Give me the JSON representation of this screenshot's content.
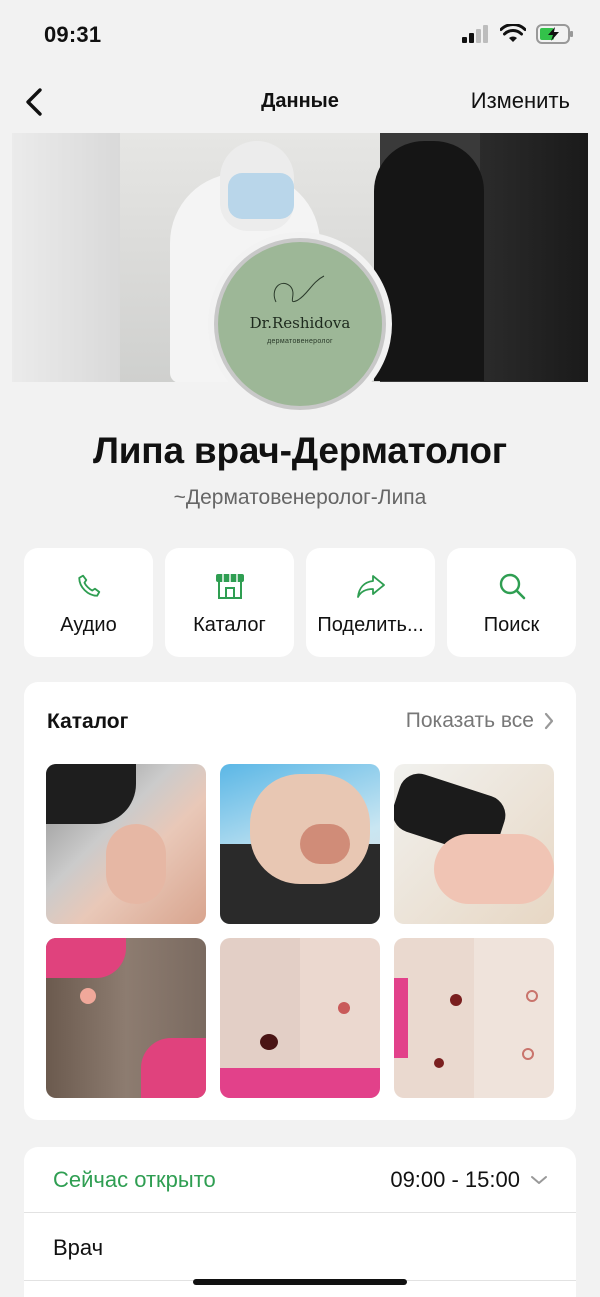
{
  "status_bar": {
    "time": "09:31"
  },
  "nav": {
    "title": "Данные",
    "edit_label": "Изменить"
  },
  "profile": {
    "avatar_brand": "Dr.Reshidova",
    "avatar_subtitle": "дерматовенеролог",
    "name": "Липа врач-Дерматолог",
    "subtitle": "~Дерматовенеролог-Липа"
  },
  "actions": [
    {
      "label": "Аудио",
      "icon": "phone-icon"
    },
    {
      "label": "Каталог",
      "icon": "store-icon"
    },
    {
      "label": "Поделить...",
      "icon": "share-icon"
    },
    {
      "label": "Поиск",
      "icon": "search-icon"
    }
  ],
  "catalog": {
    "title": "Каталог",
    "show_all_label": "Показать все"
  },
  "hours": {
    "status": "Сейчас открыто",
    "time": "09:00 - 15:00",
    "type": "Врач"
  },
  "colors": {
    "accent": "#2f9e52",
    "background": "#f2f2f2",
    "avatar_bg": "#9db797"
  }
}
